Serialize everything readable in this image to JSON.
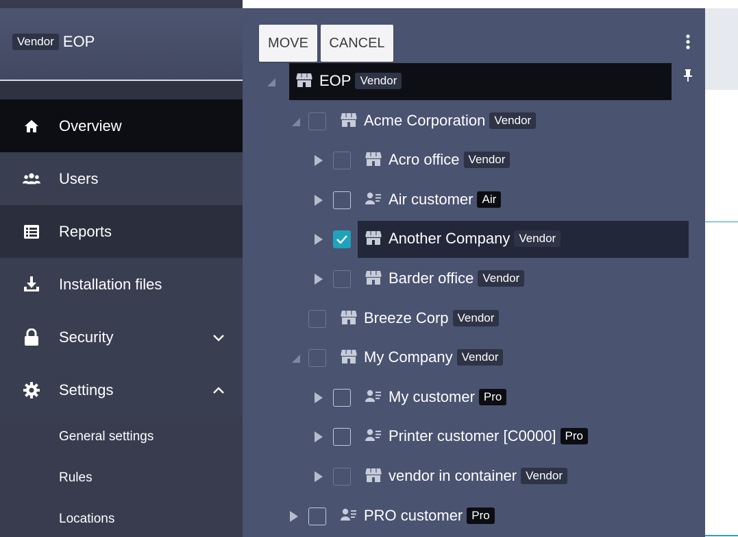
{
  "sidebar": {
    "brand_badge": "Vendor",
    "brand_name": "EOP",
    "nav": [
      {
        "label": "Overview",
        "icon": "home-icon"
      },
      {
        "label": "Users",
        "icon": "users-icon"
      },
      {
        "label": "Reports",
        "icon": "reports-icon"
      },
      {
        "label": "Installation files",
        "icon": "download-icon"
      },
      {
        "label": "Security",
        "icon": "lock-icon",
        "chevron": "chevron-down-icon"
      },
      {
        "label": "Settings",
        "icon": "gear-icon",
        "chevron": "chevron-up-icon"
      }
    ],
    "sub": [
      {
        "label": "General settings"
      },
      {
        "label": "Rules"
      },
      {
        "label": "Locations"
      }
    ]
  },
  "dialog": {
    "move_label": "MOVE",
    "cancel_label": "CANCEL",
    "tree": [
      {
        "name": "EOP",
        "badge": "Vendor",
        "icon": "store-icon"
      },
      {
        "name": "Acme Corporation",
        "badge": "Vendor",
        "icon": "store-icon"
      },
      {
        "name": "Acro office",
        "badge": "Vendor",
        "icon": "store-icon"
      },
      {
        "name": "Air customer",
        "badge": "Air",
        "icon": "customer-icon"
      },
      {
        "name": "Another Company",
        "badge": "Vendor",
        "icon": "store-icon",
        "checked": true
      },
      {
        "name": "Barder office",
        "badge": "Vendor",
        "icon": "store-icon"
      },
      {
        "name": "Breeze Corp",
        "badge": "Vendor",
        "icon": "store-icon"
      },
      {
        "name": "My Company",
        "badge": "Vendor",
        "icon": "store-icon"
      },
      {
        "name": "My customer",
        "badge": "Pro",
        "icon": "customer-icon"
      },
      {
        "name": "Printer customer [C0000]",
        "badge": "Pro",
        "icon": "customer-icon"
      },
      {
        "name": "vendor in container",
        "badge": "Vendor",
        "icon": "store-icon"
      },
      {
        "name": "PRO customer",
        "badge": "Pro",
        "icon": "customer-icon"
      }
    ]
  },
  "colors": {
    "panel": "#4a5370",
    "sidebar": "#383c4e",
    "active_nav": "#0d0e13",
    "checkbox_checked": "#1fa3bc"
  }
}
